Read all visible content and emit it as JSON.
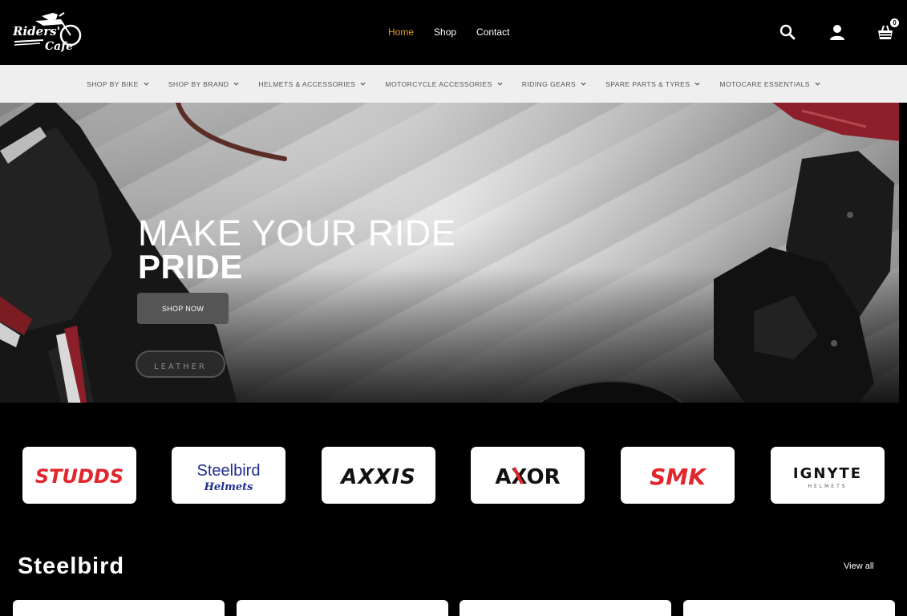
{
  "header": {
    "logo_text": "Riders Cafe",
    "nav": [
      {
        "label": "Home",
        "active": true
      },
      {
        "label": "Shop",
        "active": false
      },
      {
        "label": "Contact",
        "active": false
      }
    ],
    "icons": [
      "search-icon",
      "user-icon",
      "cart-icon"
    ],
    "cart_count": "0",
    "accent_color": "#e39b2c"
  },
  "categories": [
    "SHOP BY BIKE",
    "SHOP BY BRAND",
    "HELMETS & ACCESSORIES",
    "MOTORCYCLE ACCESSORIES",
    "RIDING GEARS",
    "SPARE PARTS & TYRES",
    "MOTOCARE ESSENTIALS"
  ],
  "hero": {
    "title_line1": "MAKE YOUR RIDE",
    "title_line2": "PRIDE",
    "cta_label": "SHOP NOW",
    "jacket_print": "LEATHER"
  },
  "brands": [
    {
      "name": "STUDDS",
      "color": "#e1262c"
    },
    {
      "name": "Steelbird",
      "sub": "Helmets",
      "color": "#1f2e8f"
    },
    {
      "name": "AXXIS",
      "color": "#111111"
    },
    {
      "name": "AXOR",
      "color": "#111111"
    },
    {
      "name": "SMK",
      "color": "#e1262c"
    },
    {
      "name": "IGNYTE",
      "sub": "HELMETS",
      "color": "#111111"
    }
  ],
  "section": {
    "title": "Steelbird",
    "view_all": "View all"
  }
}
